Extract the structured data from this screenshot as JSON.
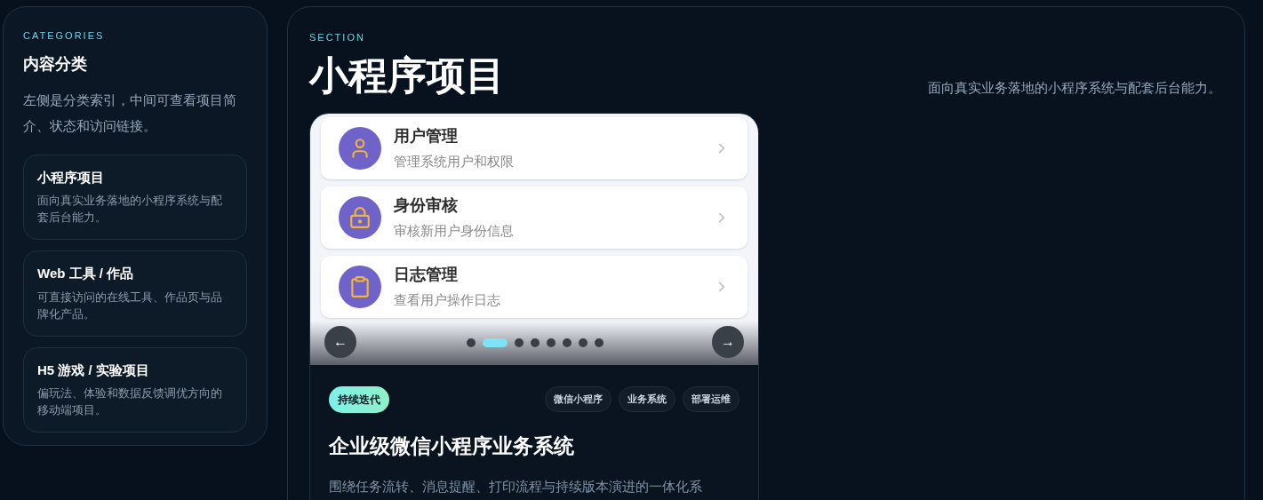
{
  "sidebar": {
    "eyebrow": "CATEGORIES",
    "title": "内容分类",
    "intro": "左侧是分类索引，中间可查看项目简介、状态和访问链接。",
    "items": [
      {
        "title": "小程序项目",
        "description": "面向真实业务落地的小程序系统与配套后台能力。"
      },
      {
        "title": "Web 工具 / 作品",
        "description": "可直接访问的在线工具、作品页与品牌化产品。"
      },
      {
        "title": "H5 游戏 / 实验项目",
        "description": "偏玩法、体验和数据反馈调优方向的移动端项目。"
      }
    ]
  },
  "section": {
    "eyebrow": "SECTION",
    "title": "小程序项目",
    "description": "面向真实业务落地的小程序系统与配套后台能力。"
  },
  "project": {
    "preview": {
      "rows": [
        {
          "kind": "user",
          "title": "用户管理",
          "subtitle": "管理系统用户和权限"
        },
        {
          "kind": "lock",
          "title": "身份审核",
          "subtitle": "审核新用户身份信息"
        },
        {
          "kind": "clipboard",
          "title": "日志管理",
          "subtitle": "查看用户操作日志"
        }
      ],
      "prev": "←",
      "next": "→",
      "dots": [
        {
          "selected": false
        },
        {
          "selected": true
        },
        {
          "selected": false
        },
        {
          "selected": false
        },
        {
          "selected": false
        },
        {
          "selected": false
        },
        {
          "selected": false
        },
        {
          "selected": false
        }
      ]
    },
    "status": "持续迭代",
    "tags": [
      "微信小程序",
      "业务系统",
      "部署运维"
    ],
    "title": "企业级微信小程序业务系统",
    "description": "围绕任务流转、消息提醒、打印流程与持续版本演进的一体化系"
  }
}
